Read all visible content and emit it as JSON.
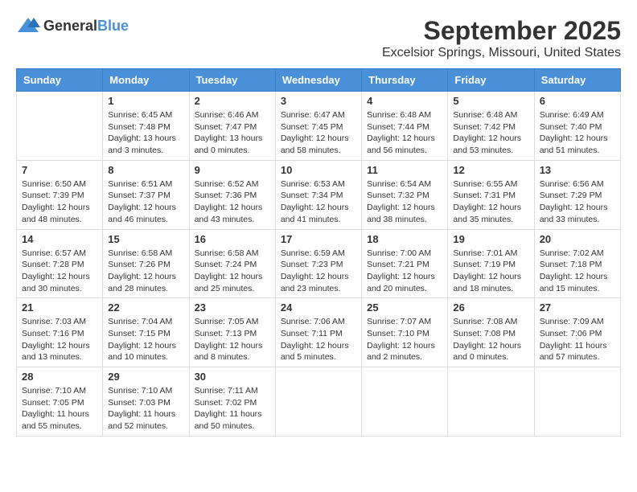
{
  "header": {
    "logo_general": "General",
    "logo_blue": "Blue",
    "month": "September 2025",
    "location": "Excelsior Springs, Missouri, United States"
  },
  "weekdays": [
    "Sunday",
    "Monday",
    "Tuesday",
    "Wednesday",
    "Thursday",
    "Friday",
    "Saturday"
  ],
  "weeks": [
    [
      {
        "day": "",
        "sunrise": "",
        "sunset": "",
        "daylight": ""
      },
      {
        "day": "1",
        "sunrise": "Sunrise: 6:45 AM",
        "sunset": "Sunset: 7:48 PM",
        "daylight": "Daylight: 13 hours and 3 minutes."
      },
      {
        "day": "2",
        "sunrise": "Sunrise: 6:46 AM",
        "sunset": "Sunset: 7:47 PM",
        "daylight": "Daylight: 13 hours and 0 minutes."
      },
      {
        "day": "3",
        "sunrise": "Sunrise: 6:47 AM",
        "sunset": "Sunset: 7:45 PM",
        "daylight": "Daylight: 12 hours and 58 minutes."
      },
      {
        "day": "4",
        "sunrise": "Sunrise: 6:48 AM",
        "sunset": "Sunset: 7:44 PM",
        "daylight": "Daylight: 12 hours and 56 minutes."
      },
      {
        "day": "5",
        "sunrise": "Sunrise: 6:48 AM",
        "sunset": "Sunset: 7:42 PM",
        "daylight": "Daylight: 12 hours and 53 minutes."
      },
      {
        "day": "6",
        "sunrise": "Sunrise: 6:49 AM",
        "sunset": "Sunset: 7:40 PM",
        "daylight": "Daylight: 12 hours and 51 minutes."
      }
    ],
    [
      {
        "day": "7",
        "sunrise": "Sunrise: 6:50 AM",
        "sunset": "Sunset: 7:39 PM",
        "daylight": "Daylight: 12 hours and 48 minutes."
      },
      {
        "day": "8",
        "sunrise": "Sunrise: 6:51 AM",
        "sunset": "Sunset: 7:37 PM",
        "daylight": "Daylight: 12 hours and 46 minutes."
      },
      {
        "day": "9",
        "sunrise": "Sunrise: 6:52 AM",
        "sunset": "Sunset: 7:36 PM",
        "daylight": "Daylight: 12 hours and 43 minutes."
      },
      {
        "day": "10",
        "sunrise": "Sunrise: 6:53 AM",
        "sunset": "Sunset: 7:34 PM",
        "daylight": "Daylight: 12 hours and 41 minutes."
      },
      {
        "day": "11",
        "sunrise": "Sunrise: 6:54 AM",
        "sunset": "Sunset: 7:32 PM",
        "daylight": "Daylight: 12 hours and 38 minutes."
      },
      {
        "day": "12",
        "sunrise": "Sunrise: 6:55 AM",
        "sunset": "Sunset: 7:31 PM",
        "daylight": "Daylight: 12 hours and 35 minutes."
      },
      {
        "day": "13",
        "sunrise": "Sunrise: 6:56 AM",
        "sunset": "Sunset: 7:29 PM",
        "daylight": "Daylight: 12 hours and 33 minutes."
      }
    ],
    [
      {
        "day": "14",
        "sunrise": "Sunrise: 6:57 AM",
        "sunset": "Sunset: 7:28 PM",
        "daylight": "Daylight: 12 hours and 30 minutes."
      },
      {
        "day": "15",
        "sunrise": "Sunrise: 6:58 AM",
        "sunset": "Sunset: 7:26 PM",
        "daylight": "Daylight: 12 hours and 28 minutes."
      },
      {
        "day": "16",
        "sunrise": "Sunrise: 6:58 AM",
        "sunset": "Sunset: 7:24 PM",
        "daylight": "Daylight: 12 hours and 25 minutes."
      },
      {
        "day": "17",
        "sunrise": "Sunrise: 6:59 AM",
        "sunset": "Sunset: 7:23 PM",
        "daylight": "Daylight: 12 hours and 23 minutes."
      },
      {
        "day": "18",
        "sunrise": "Sunrise: 7:00 AM",
        "sunset": "Sunset: 7:21 PM",
        "daylight": "Daylight: 12 hours and 20 minutes."
      },
      {
        "day": "19",
        "sunrise": "Sunrise: 7:01 AM",
        "sunset": "Sunset: 7:19 PM",
        "daylight": "Daylight: 12 hours and 18 minutes."
      },
      {
        "day": "20",
        "sunrise": "Sunrise: 7:02 AM",
        "sunset": "Sunset: 7:18 PM",
        "daylight": "Daylight: 12 hours and 15 minutes."
      }
    ],
    [
      {
        "day": "21",
        "sunrise": "Sunrise: 7:03 AM",
        "sunset": "Sunset: 7:16 PM",
        "daylight": "Daylight: 12 hours and 13 minutes."
      },
      {
        "day": "22",
        "sunrise": "Sunrise: 7:04 AM",
        "sunset": "Sunset: 7:15 PM",
        "daylight": "Daylight: 12 hours and 10 minutes."
      },
      {
        "day": "23",
        "sunrise": "Sunrise: 7:05 AM",
        "sunset": "Sunset: 7:13 PM",
        "daylight": "Daylight: 12 hours and 8 minutes."
      },
      {
        "day": "24",
        "sunrise": "Sunrise: 7:06 AM",
        "sunset": "Sunset: 7:11 PM",
        "daylight": "Daylight: 12 hours and 5 minutes."
      },
      {
        "day": "25",
        "sunrise": "Sunrise: 7:07 AM",
        "sunset": "Sunset: 7:10 PM",
        "daylight": "Daylight: 12 hours and 2 minutes."
      },
      {
        "day": "26",
        "sunrise": "Sunrise: 7:08 AM",
        "sunset": "Sunset: 7:08 PM",
        "daylight": "Daylight: 12 hours and 0 minutes."
      },
      {
        "day": "27",
        "sunrise": "Sunrise: 7:09 AM",
        "sunset": "Sunset: 7:06 PM",
        "daylight": "Daylight: 11 hours and 57 minutes."
      }
    ],
    [
      {
        "day": "28",
        "sunrise": "Sunrise: 7:10 AM",
        "sunset": "Sunset: 7:05 PM",
        "daylight": "Daylight: 11 hours and 55 minutes."
      },
      {
        "day": "29",
        "sunrise": "Sunrise: 7:10 AM",
        "sunset": "Sunset: 7:03 PM",
        "daylight": "Daylight: 11 hours and 52 minutes."
      },
      {
        "day": "30",
        "sunrise": "Sunrise: 7:11 AM",
        "sunset": "Sunset: 7:02 PM",
        "daylight": "Daylight: 11 hours and 50 minutes."
      },
      {
        "day": "",
        "sunrise": "",
        "sunset": "",
        "daylight": ""
      },
      {
        "day": "",
        "sunrise": "",
        "sunset": "",
        "daylight": ""
      },
      {
        "day": "",
        "sunrise": "",
        "sunset": "",
        "daylight": ""
      },
      {
        "day": "",
        "sunrise": "",
        "sunset": "",
        "daylight": ""
      }
    ]
  ]
}
